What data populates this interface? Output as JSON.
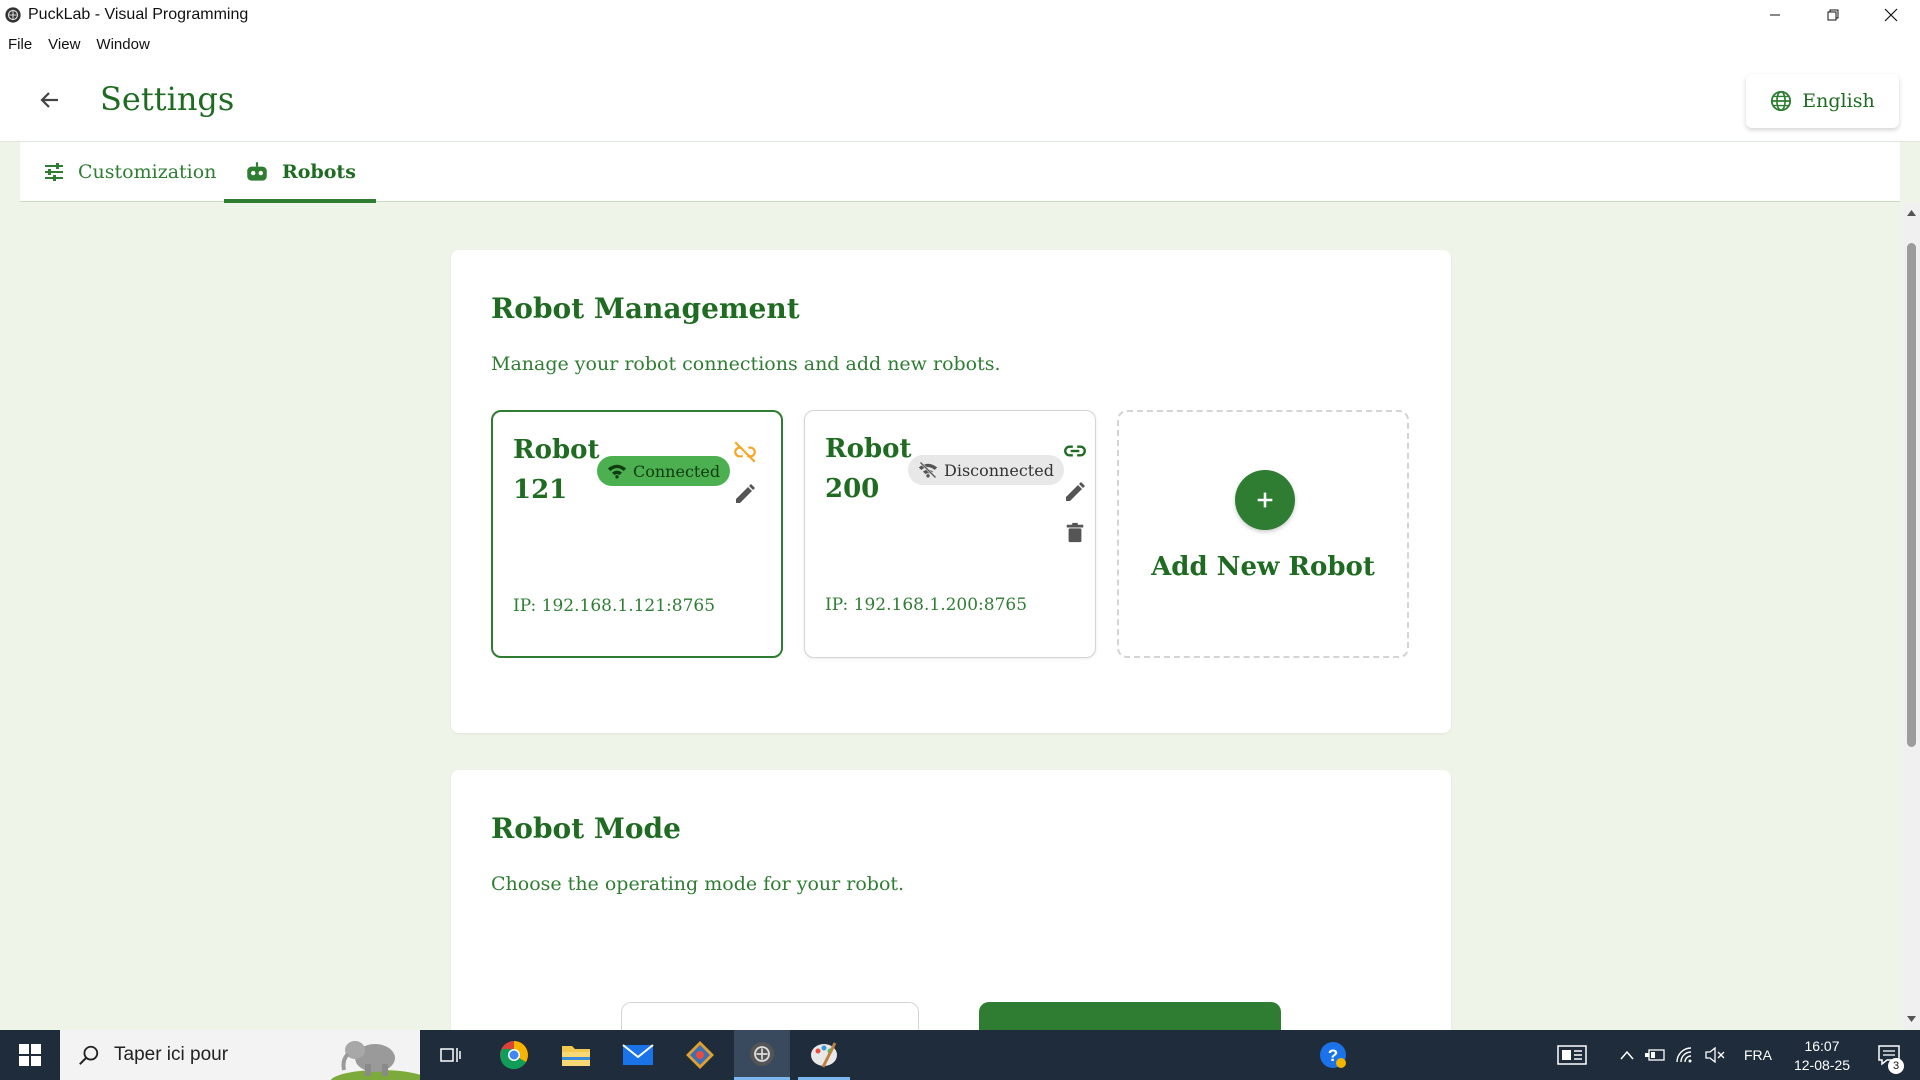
{
  "window": {
    "title": "PuckLab - Visual Programming"
  },
  "menu": [
    "File",
    "View",
    "Window"
  ],
  "header": {
    "title": "Settings",
    "language": "English"
  },
  "tabs": [
    {
      "label": "Customization",
      "icon": "tune-icon"
    },
    {
      "label": "Robots",
      "icon": "robot-icon",
      "active": true
    }
  ],
  "robot_management": {
    "title": "Robot Management",
    "description": "Manage your robot connections and add new robots.",
    "robots": [
      {
        "name": "Robot 121",
        "status": "Connected",
        "ip": "IP: 192.168.1.121:8765"
      },
      {
        "name": "Robot 200",
        "status": "Disconnected",
        "ip": "IP: 192.168.1.200:8765"
      }
    ],
    "add_label": "Add New Robot"
  },
  "robot_mode": {
    "title": "Robot Mode",
    "description": "Choose the operating mode for your robot."
  },
  "taskbar": {
    "search_placeholder": "Taper ici pour",
    "language": "FRA",
    "time": "16:07",
    "date": "12-08-25",
    "notifications": "3"
  },
  "colors": {
    "primary": "#2e7d32",
    "background": "#eef5e8",
    "taskbar": "#1f2c3c",
    "warning": "#f5a623"
  }
}
